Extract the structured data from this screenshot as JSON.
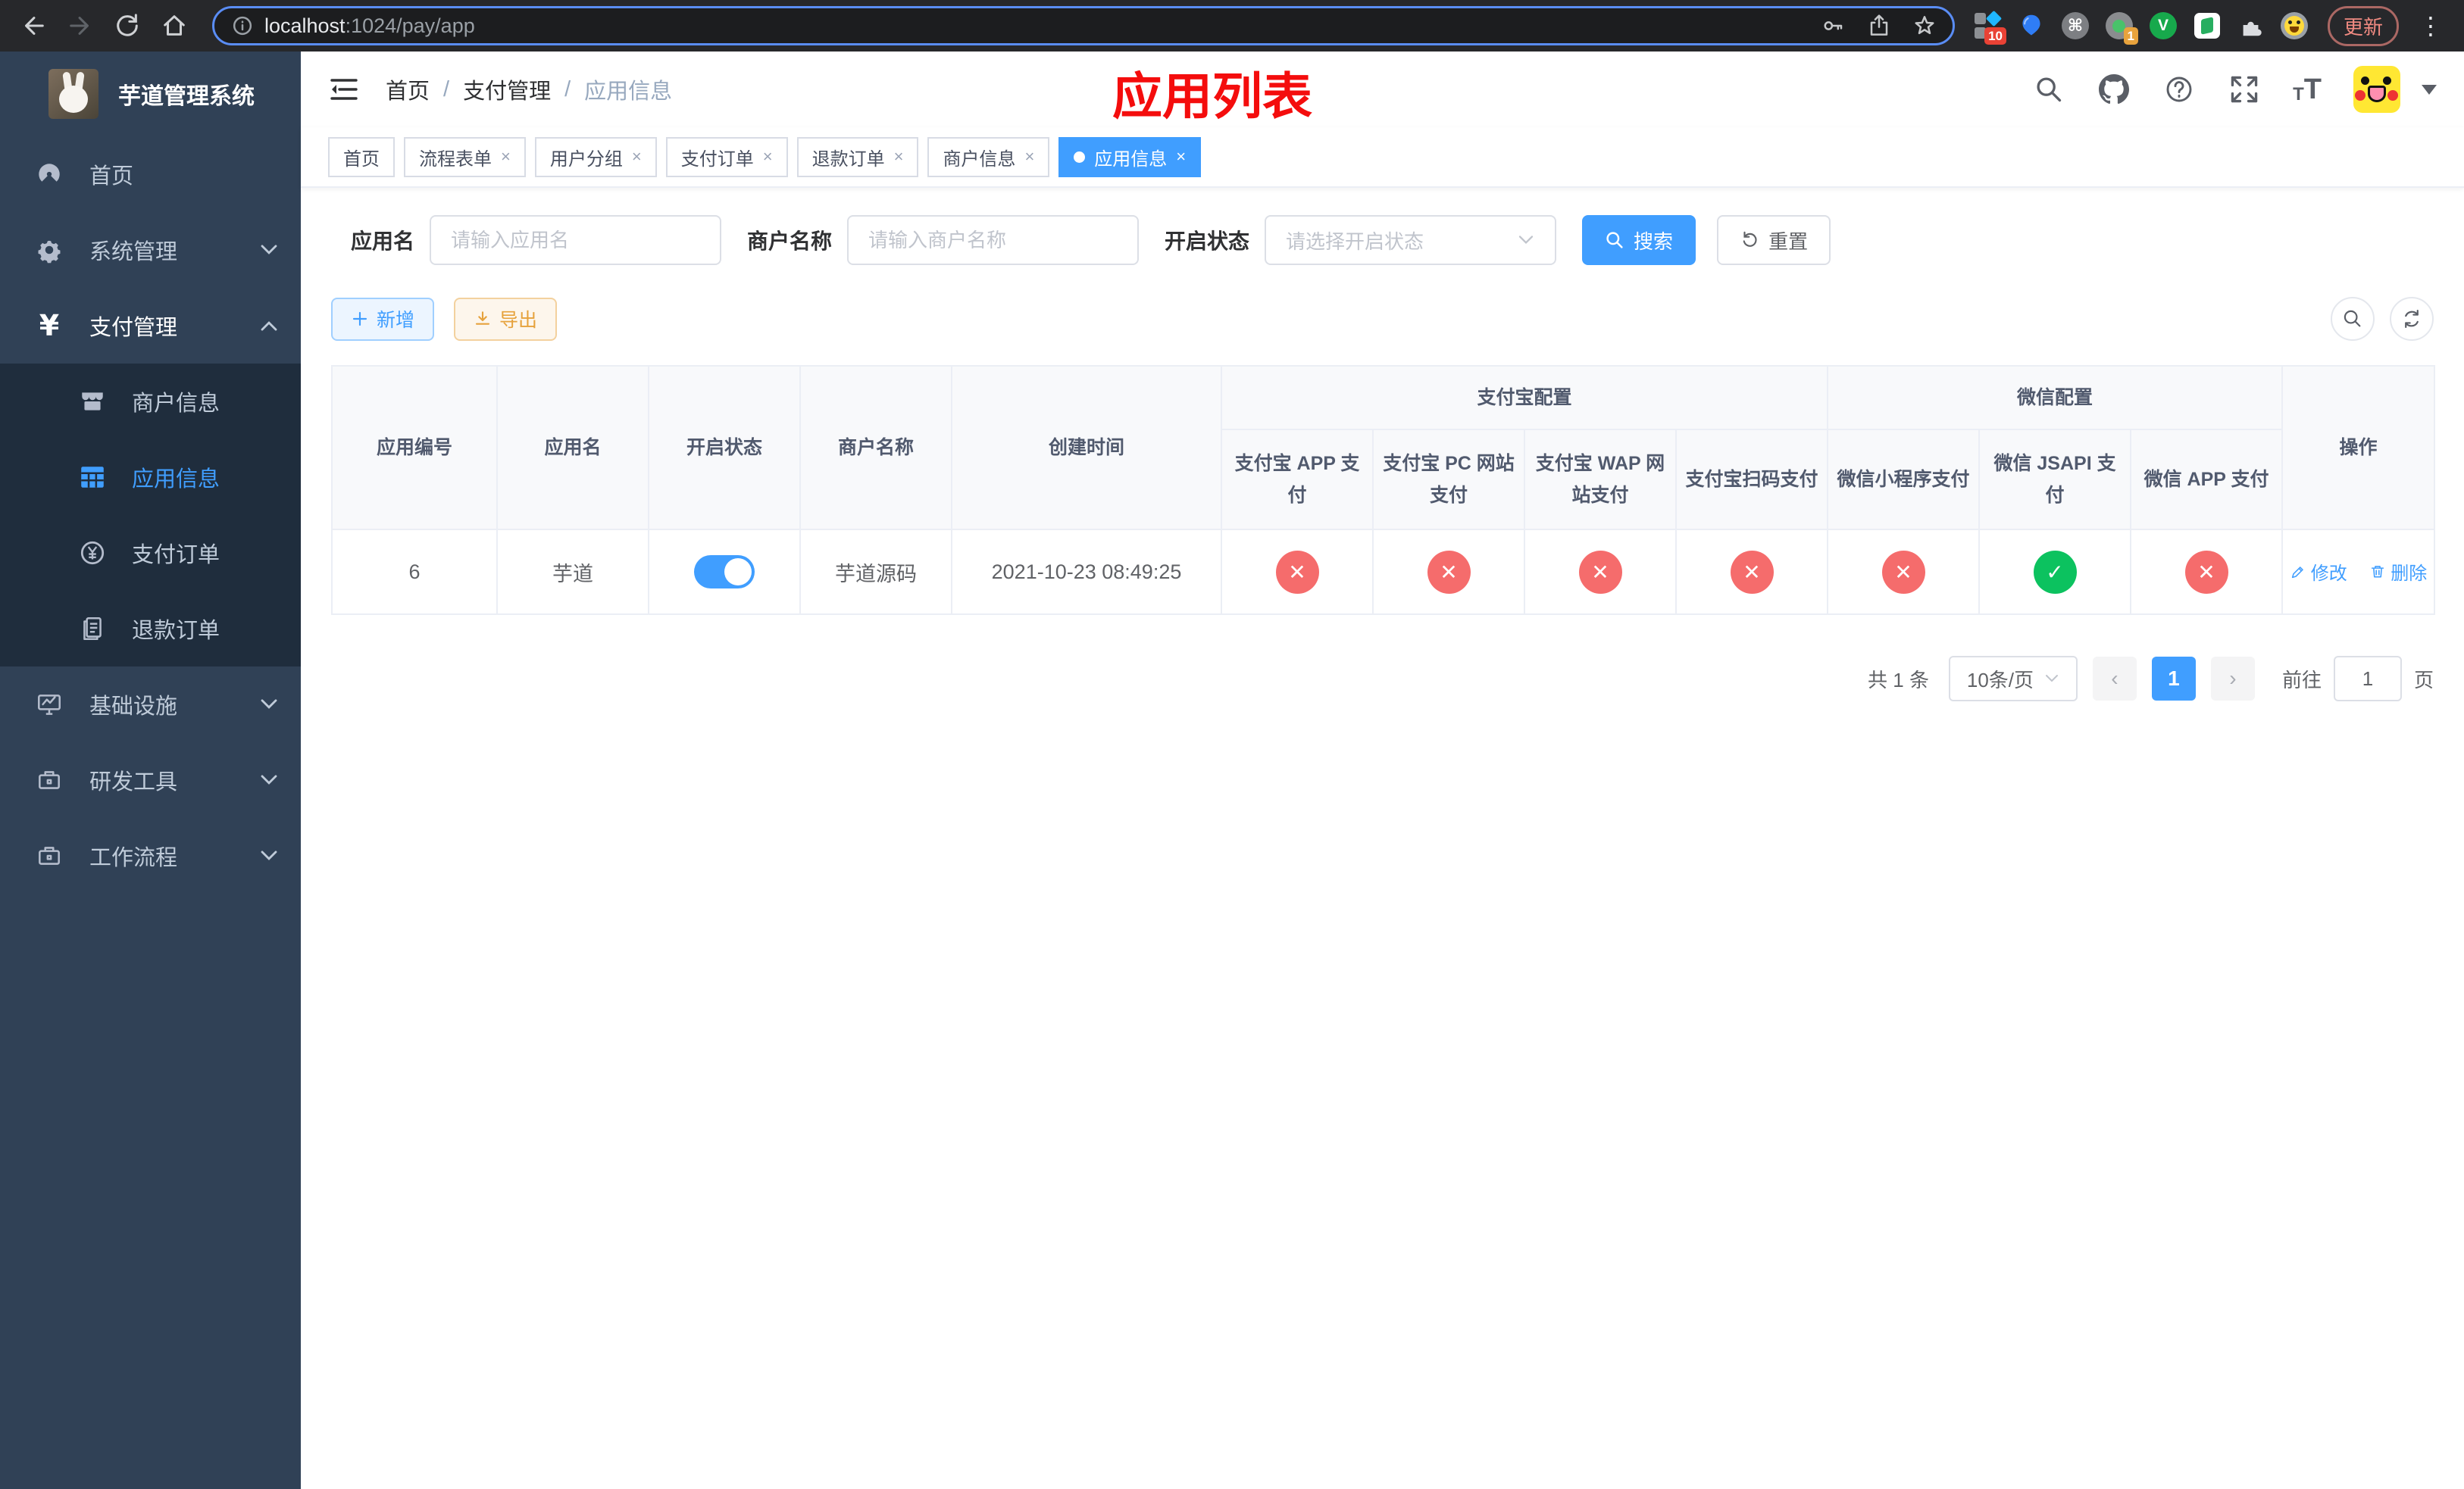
{
  "browser": {
    "url": {
      "host": "localhost",
      "path": ":1024/pay/app"
    },
    "extensions": {
      "badge_ten": "10",
      "badge_one": "1",
      "v_letter": "V"
    },
    "update_button": "更新"
  },
  "sidebar": {
    "title": "芋道管理系统",
    "items": [
      {
        "label": "首页"
      },
      {
        "label": "系统管理"
      },
      {
        "label": "支付管理"
      },
      {
        "label": "基础设施"
      },
      {
        "label": "研发工具"
      },
      {
        "label": "工作流程"
      }
    ],
    "submenu": [
      {
        "label": "商户信息"
      },
      {
        "label": "应用信息"
      },
      {
        "label": "支付订单"
      },
      {
        "label": "退款订单"
      }
    ]
  },
  "header": {
    "breadcrumb": [
      "首页",
      "支付管理",
      "应用信息"
    ],
    "page_title": "应用列表"
  },
  "tabs": [
    {
      "label": "首页"
    },
    {
      "label": "流程表单"
    },
    {
      "label": "用户分组"
    },
    {
      "label": "支付订单"
    },
    {
      "label": "退款订单"
    },
    {
      "label": "商户信息"
    },
    {
      "label": "应用信息"
    }
  ],
  "filters": {
    "app_name_label": "应用名",
    "app_name_placeholder": "请输入应用名",
    "merchant_label": "商户名称",
    "merchant_placeholder": "请输入商户名称",
    "status_label": "开启状态",
    "status_placeholder": "请选择开启状态",
    "search_button": "搜索",
    "reset_button": "重置"
  },
  "toolbar": {
    "add_button": "新增",
    "export_button": "导出"
  },
  "table": {
    "headers": {
      "app_id": "应用编号",
      "app_name": "应用名",
      "status": "开启状态",
      "merchant": "商户名称",
      "create_time": "创建时间",
      "alipay_group": "支付宝配置",
      "wechat_group": "微信配置",
      "alipay_app": "支付宝 APP 支付",
      "alipay_pc": "支付宝 PC 网站支付",
      "alipay_wap": "支付宝 WAP 网站支付",
      "alipay_qr": "支付宝扫码支付",
      "wx_lite": "微信小程序支付",
      "wx_jsapi": "微信 JSAPI 支付",
      "wx_app": "微信 APP 支付",
      "actions": "操作"
    },
    "row": {
      "app_id": "6",
      "app_name": "芋道",
      "enabled": true,
      "merchant": "芋道源码",
      "create_time": "2021-10-23 08:49:25",
      "configs": {
        "alipay_app": false,
        "alipay_pc": false,
        "alipay_wap": false,
        "alipay_qr": false,
        "wx_lite": false,
        "wx_jsapi": true,
        "wx_app": false
      },
      "edit_label": "修改",
      "delete_label": "删除"
    }
  },
  "pagination": {
    "total": "共 1 条",
    "page_size": "10条/页",
    "current_page": "1",
    "goto_label": "前往",
    "goto_value": "1",
    "page_unit": "页"
  },
  "colors": {
    "accent": "#409eff",
    "danger": "#f56c6c",
    "success": "#0cc25f",
    "sidebar_bg": "#304156",
    "submenu_bg": "#1f2d3d",
    "title_red": "#f40d0d",
    "add_btn_bg": "#ecf5ff",
    "export_btn_bg": "#fdf6ec"
  }
}
